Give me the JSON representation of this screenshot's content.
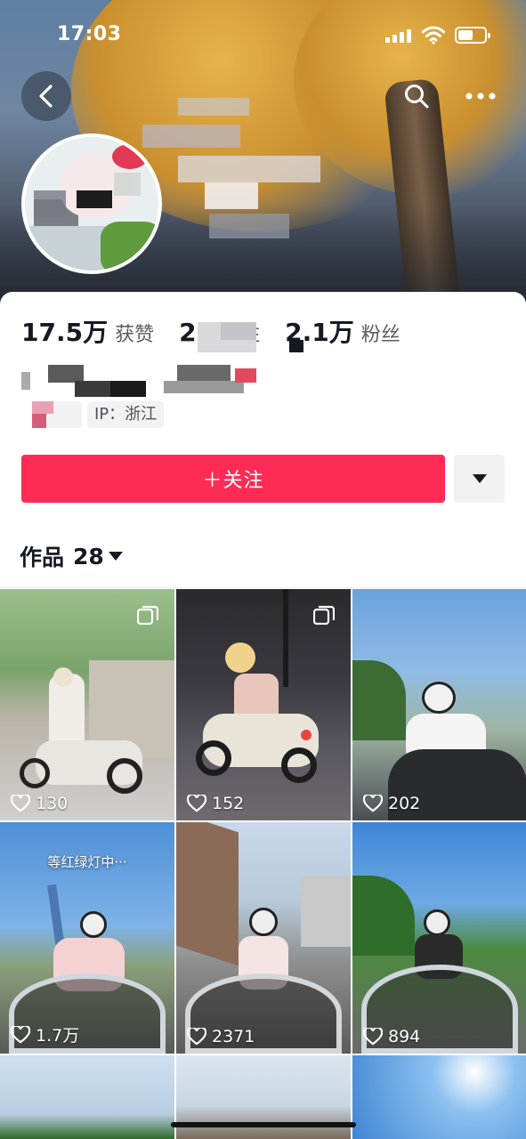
{
  "status_bar": {
    "time": "17:03"
  },
  "profile": {
    "stats": [
      {
        "value": "17.5万",
        "label": "获赞"
      },
      {
        "value": "25",
        "label": "关注"
      },
      {
        "value": "2.1万",
        "label": "粉丝"
      }
    ],
    "ip_location": "IP：浙江"
  },
  "actions": {
    "follow_label": "＋关注"
  },
  "works": {
    "label": "作品",
    "count": "28"
  },
  "grid": {
    "tiles": [
      {
        "likes": "130",
        "multi": true
      },
      {
        "likes": "152",
        "multi": true
      },
      {
        "likes": "202",
        "multi": false
      },
      {
        "likes": "1.7万",
        "multi": false,
        "caption": "等红绿灯中···"
      },
      {
        "likes": "2371",
        "multi": false
      },
      {
        "likes": "894",
        "multi": false
      }
    ]
  },
  "colors": {
    "follow_button": "#fe2c55",
    "text_primary": "#161823",
    "text_secondary": "#5a5b63"
  }
}
